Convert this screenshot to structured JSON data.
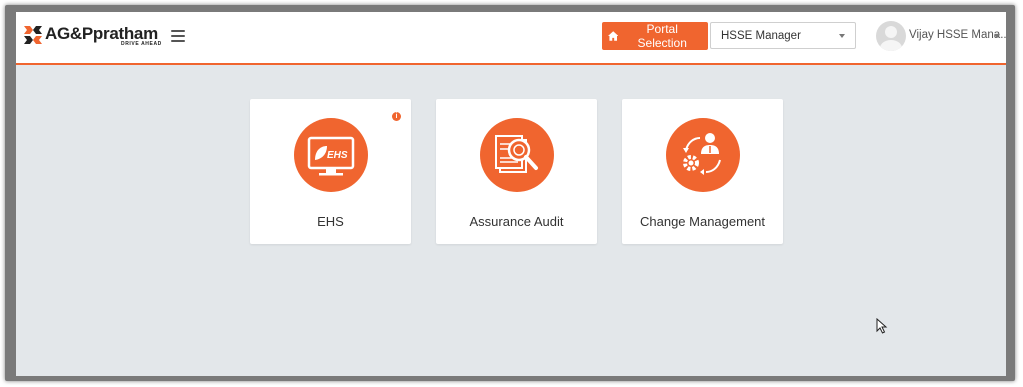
{
  "header": {
    "logo_text": "AG&P",
    "logo_text2": "pratham",
    "logo_tagline": "DRIVE AHEAD",
    "portal_button_label": "Portal Selection",
    "role_select_value": "HSSE Manager",
    "user_name": "Vijay HSSE Mana..."
  },
  "cards": [
    {
      "label": "EHS",
      "icon": "ehs-monitor-leaf-icon",
      "icon_text": "EHS"
    },
    {
      "label": "Assurance Audit",
      "icon": "document-magnifier-icon"
    },
    {
      "label": "Change Management",
      "icon": "person-gear-cycle-icon"
    }
  ],
  "info_badge": "i",
  "colors": {
    "accent": "#f0652f",
    "background": "#e3e7ea",
    "header_bg": "#ffffff"
  }
}
